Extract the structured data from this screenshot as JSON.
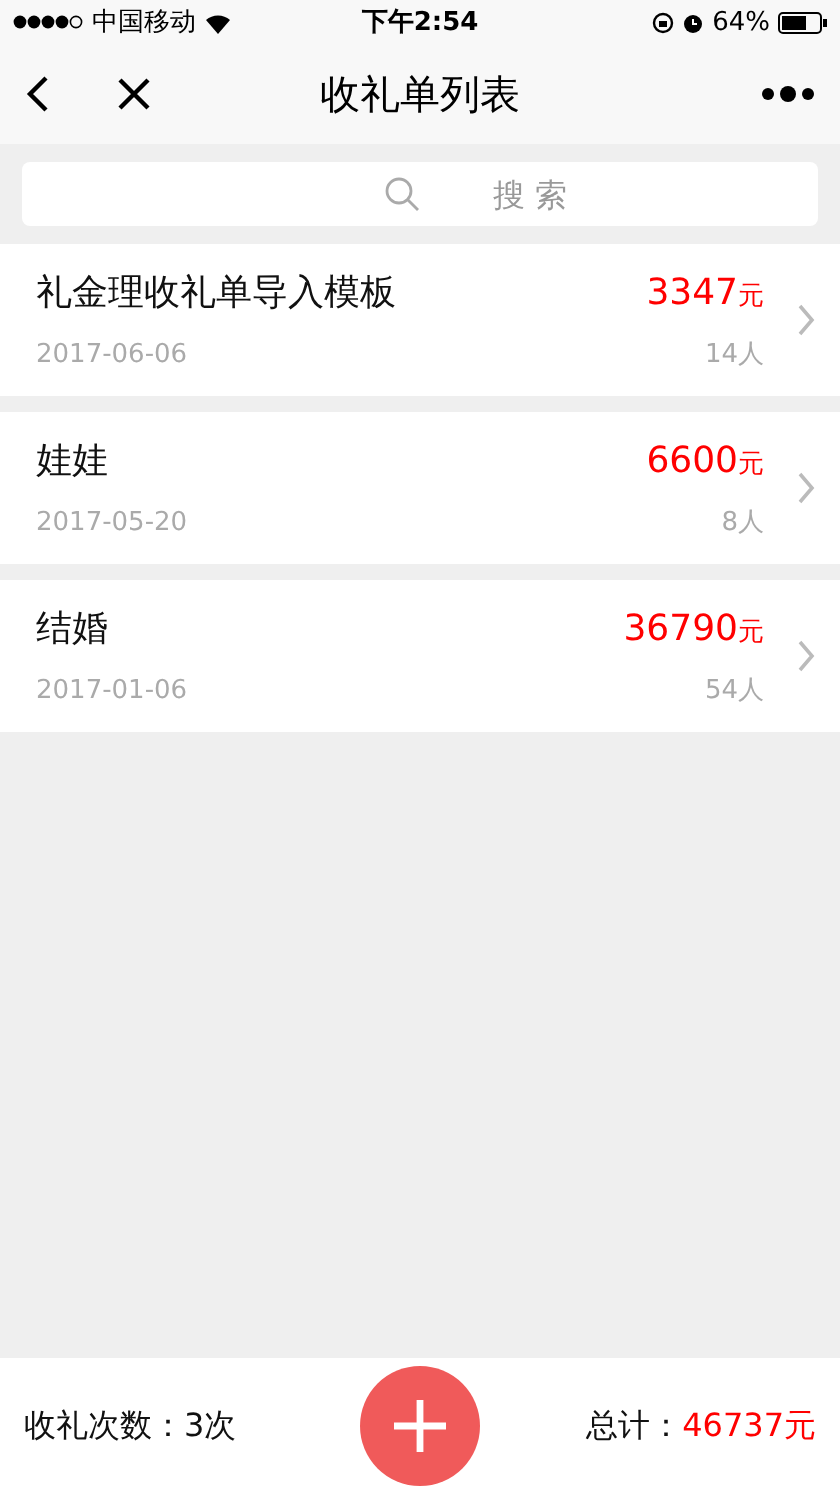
{
  "status_bar": {
    "carrier": "中国移动",
    "time": "下午2:54",
    "battery": "64%"
  },
  "nav": {
    "title": "收礼单列表"
  },
  "search": {
    "placeholder": "搜 索"
  },
  "records": [
    {
      "name": "礼金理收礼单导入模板",
      "date": "2017-06-06",
      "amount": "3347",
      "unit": "元",
      "people": "14人"
    },
    {
      "name": "娃娃",
      "date": "2017-05-20",
      "amount": "6600",
      "unit": "元",
      "people": "8人"
    },
    {
      "name": "结婚",
      "date": "2017-01-06",
      "amount": "36790",
      "unit": "元",
      "people": "54人"
    }
  ],
  "footer": {
    "count_label": "收礼次数：",
    "count": "3次",
    "total_label": "总计：",
    "total": "46737元"
  }
}
